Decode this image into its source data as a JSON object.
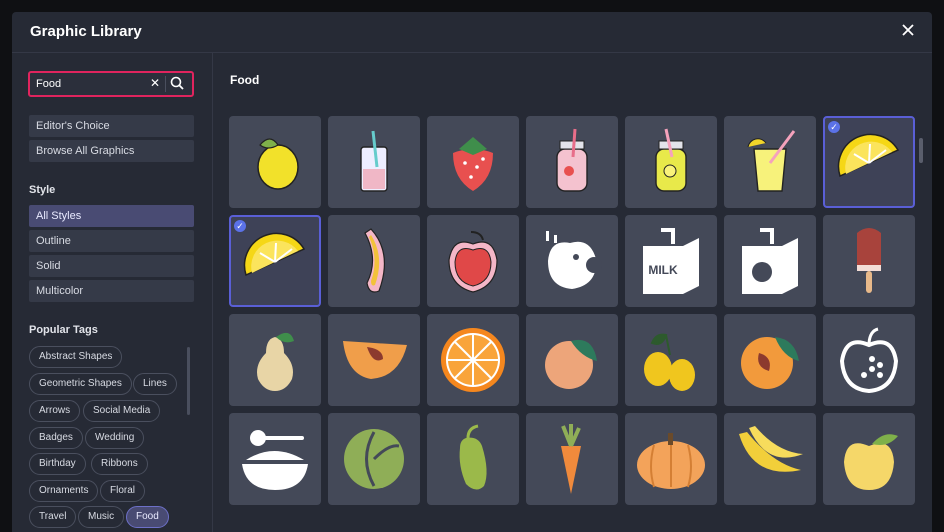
{
  "modal": {
    "title": "Graphic Library"
  },
  "search": {
    "value": "Food"
  },
  "nav": {
    "editors_choice": "Editor's Choice",
    "browse_all": "Browse All Graphics"
  },
  "style": {
    "heading": "Style",
    "options": [
      "All Styles",
      "Outline",
      "Solid",
      "Multicolor"
    ],
    "selected": "All Styles"
  },
  "tags": {
    "heading": "Popular Tags",
    "items": [
      "Abstract Shapes",
      "Geometric Shapes",
      "Lines",
      "Arrows",
      "Social Media",
      "Badges",
      "Wedding",
      "Birthday",
      "Ribbons",
      "Ornaments",
      "Floral",
      "Travel",
      "Music",
      "Food"
    ],
    "selected": "Food"
  },
  "results": {
    "heading": "Food",
    "items": [
      {
        "icon": "lemon-icon",
        "selected": false
      },
      {
        "icon": "drink-glass-icon",
        "selected": false
      },
      {
        "icon": "strawberry-icon",
        "selected": false
      },
      {
        "icon": "strawberry-jar-icon",
        "selected": false
      },
      {
        "icon": "lemonade-jar-icon",
        "selected": false
      },
      {
        "icon": "juice-glass-icon",
        "selected": false
      },
      {
        "icon": "lemon-slice-icon",
        "selected": true
      },
      {
        "icon": "lemon-slice-icon",
        "selected": true
      },
      {
        "icon": "banana-sticker-icon",
        "selected": false
      },
      {
        "icon": "apple-sticker-icon",
        "selected": false
      },
      {
        "icon": "apple-bite-icon",
        "selected": false
      },
      {
        "icon": "milk-carton-icon",
        "selected": false
      },
      {
        "icon": "juice-carton-icon",
        "selected": false
      },
      {
        "icon": "popsicle-icon",
        "selected": false
      },
      {
        "icon": "pear-icon",
        "selected": false
      },
      {
        "icon": "peach-slice-icon",
        "selected": false
      },
      {
        "icon": "orange-slice-icon",
        "selected": false
      },
      {
        "icon": "peach-icon",
        "selected": false
      },
      {
        "icon": "lemons-icon",
        "selected": false
      },
      {
        "icon": "apricot-icon",
        "selected": false
      },
      {
        "icon": "apple-outline-icon",
        "selected": false
      },
      {
        "icon": "rice-bowl-icon",
        "selected": false
      },
      {
        "icon": "cabbage-icon",
        "selected": false
      },
      {
        "icon": "cucumber-icon",
        "selected": false
      },
      {
        "icon": "carrot-icon",
        "selected": false
      },
      {
        "icon": "pumpkin-icon",
        "selected": false
      },
      {
        "icon": "bananas-icon",
        "selected": false
      },
      {
        "icon": "yellow-apple-icon",
        "selected": false
      }
    ]
  },
  "colors": {
    "accent": "#5a5fd6",
    "search_border": "#e0245e",
    "panel": "#262a35",
    "tile": "#444958"
  }
}
